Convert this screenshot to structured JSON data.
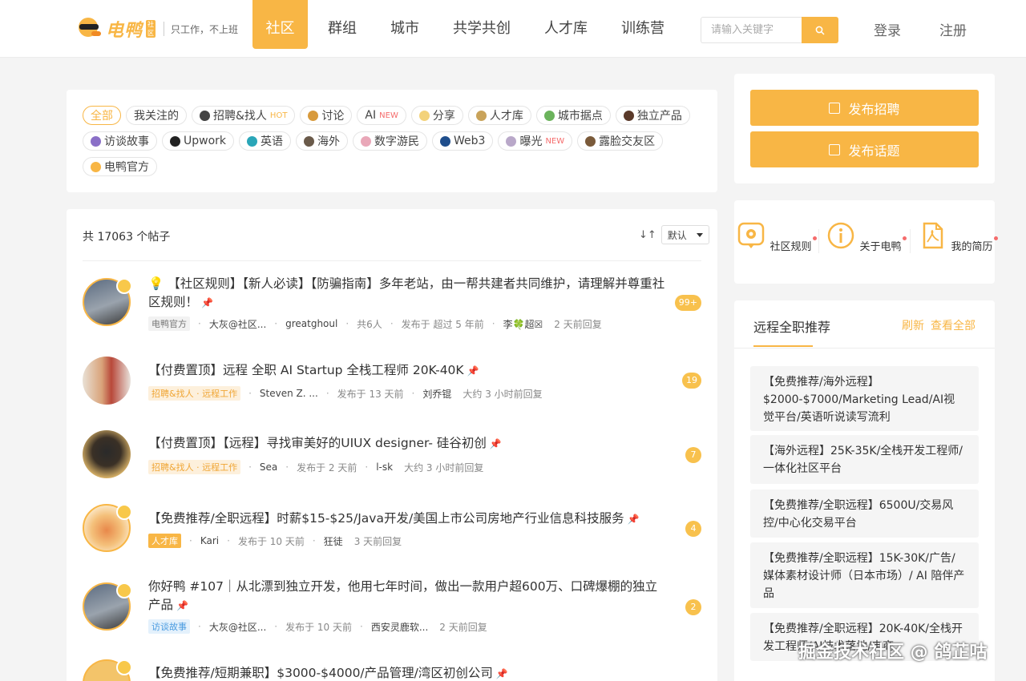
{
  "header": {
    "logo_text": "电鸭",
    "logo_badge": "社区",
    "slogan": "只工作，不上班",
    "nav": [
      "社区",
      "群组",
      "城市",
      "共学共创",
      "人才库",
      "训练营"
    ],
    "search_placeholder": "请输入关键字",
    "login": "登录",
    "register": "注册",
    "accent": "#f8b645"
  },
  "tags": [
    {
      "label": "全部",
      "active": true,
      "icon": "",
      "flag": ""
    },
    {
      "label": "我关注的",
      "icon": "",
      "flag": ""
    },
    {
      "label": "招聘&找人",
      "icon": "person-icon",
      "flag": "HOT"
    },
    {
      "label": "讨论",
      "icon": "chat-icon",
      "flag": ""
    },
    {
      "label": "AI",
      "icon": "",
      "flag": "NEW"
    },
    {
      "label": "分享",
      "icon": "share-icon",
      "flag": ""
    },
    {
      "label": "人才库",
      "icon": "talent-icon",
      "flag": ""
    },
    {
      "label": "城市据点",
      "icon": "city-icon",
      "flag": ""
    },
    {
      "label": "独立产品",
      "icon": "product-icon",
      "flag": ""
    },
    {
      "label": "访谈故事",
      "icon": "interview-icon",
      "flag": ""
    },
    {
      "label": "Upwork",
      "icon": "upwork-icon",
      "flag": ""
    },
    {
      "label": "英语",
      "icon": "english-icon",
      "flag": ""
    },
    {
      "label": "海外",
      "icon": "overseas-icon",
      "flag": ""
    },
    {
      "label": "数字游民",
      "icon": "nomad-icon",
      "flag": ""
    },
    {
      "label": "Web3",
      "icon": "web3-icon",
      "flag": ""
    },
    {
      "label": "曝光",
      "icon": "exposure-icon",
      "flag": "NEW"
    },
    {
      "label": "露脸交友区",
      "icon": "face-icon",
      "flag": ""
    },
    {
      "label": "电鸭官方",
      "icon": "duck-icon",
      "flag": ""
    }
  ],
  "posts_header": {
    "total": "共 17063 个帖子",
    "sort_icon": "↓↑",
    "sort_value": "默认"
  },
  "posts": [
    {
      "title": "💡 【社区规则】【新人必读】【防骗指南】多年老站，由一帮共建者共同维护，请理解并尊重社区规则！",
      "badge": "电鸭官方",
      "badge_style": "gray",
      "author": "大灰@社区...",
      "author2": "greatghoul",
      "people": "共6人",
      "posted": "发布于 超过 5 年前",
      "replier": "李🍀超☒",
      "replied": "2 天前回复",
      "count": "99+"
    },
    {
      "title": "【付费置顶】远程 全职 AI Startup 全栈工程师 20K-40K",
      "badge": "招聘&找人 · 远程工作",
      "badge_style": "orange",
      "author": "Steven Z. ...",
      "posted": "发布于 13 天前",
      "replier": "刘乔锟",
      "replied": "大约 3 小时前回复",
      "count": "19"
    },
    {
      "title": "【付费置顶】【远程】寻找审美好的UIUX designer- 硅谷初创",
      "badge": "招聘&找人 · 远程工作",
      "badge_style": "orange",
      "author": "Sea",
      "posted": "发布于 2 天前",
      "replier": "l-sk",
      "replied": "大约 3 小时前回复",
      "count": "7"
    },
    {
      "title": "【免费推荐/全职远程】时薪$15-$25/Java开发/美国上市公司房地产行业信息科技服务",
      "badge": "人才库",
      "badge_style": "solid",
      "author": "Kari",
      "posted": "发布于 10 天前",
      "replier": "狂徒",
      "replied": "3 天前回复",
      "count": "4"
    },
    {
      "title": "你好鸭 #107｜从北漂到独立开发，他用七年时间，做出一款用户超600万、口碑爆棚的独立产品",
      "badge": "访谈故事",
      "badge_style": "blue",
      "author": "大灰@社区...",
      "posted": "发布于 10 天前",
      "replier": "西安灵鹿软...",
      "replied": "2 天前回复",
      "count": "2"
    },
    {
      "title": "【免费推荐/短期兼职】$3000-$4000/产品管理/湾区初创公司",
      "count": ""
    }
  ],
  "sidebar": {
    "publish_job": "发布招聘",
    "publish_topic": "发布话题",
    "links": [
      "社区规则",
      "关于电鸭",
      "我的简历"
    ],
    "rec_title": "远程全职推荐",
    "rec_refresh": "刷新",
    "rec_all": "查看全部",
    "rec_items": [
      "【免费推荐/海外远程】$2000-$7000/Marketing Lead/AI视觉平台/英语听说读写流利",
      "【海外远程】25K-35K/全栈开发工程师/一体化社区平台",
      "【免费推荐/全职远程】6500U/交易风控/中心化交易平台",
      "【免费推荐/全职远程】15K-30K/广告/媒体素材设计师（日本市场）/ AI 陪伴产品",
      "【免费推荐/全职远程】20K-40K/全栈开发工程师/AI技术落地/电商"
    ]
  },
  "watermark": "掘金技术社区 @ 鸽芷咕"
}
